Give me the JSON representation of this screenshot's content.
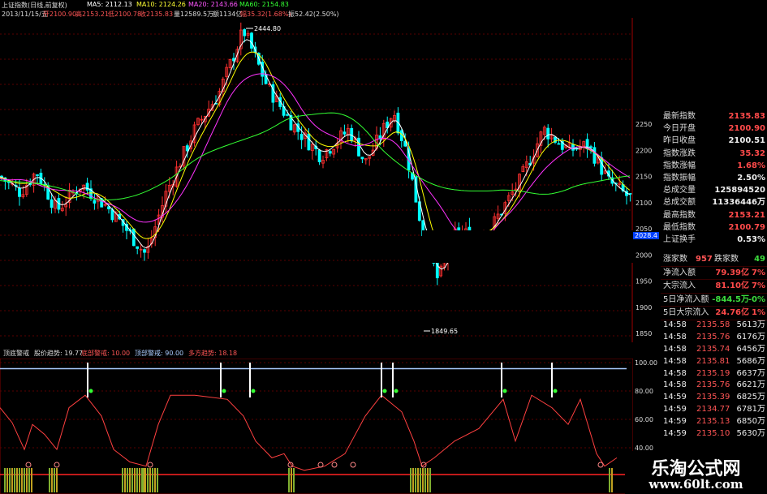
{
  "infobar": {
    "title": "上证指数(日线,前复权)",
    "ma5": "MA5: 2112.13",
    "ma10": "MA10: 2124.26",
    "ma20": "MA20: 2143.66",
    "ma60": "MA60: 2154.83",
    "date": "2013/11/15/五",
    "open": "开2100.90",
    "high": "高2153.21",
    "low": "低2100.78",
    "close": "收2135.83",
    "volume": "量12589.5万",
    "amount": "额1134亿",
    "change": "幅35.32(1.68%)",
    "amp": "振52.42(2.50%)"
  },
  "annotations": {
    "peak": "2444.80",
    "trough": "1849.65"
  },
  "main_axis": {
    "labels": [
      "2250",
      "2200",
      "2150",
      "2100",
      "2050",
      "2000",
      "1950",
      "1900",
      "1850"
    ],
    "current": "2028.4"
  },
  "indicator_bar": {
    "name": "顶底警戒",
    "trend": "股价趋势: 19.77",
    "bottom": "底部警戒: 10.00",
    "top": "顶部警戒: 90.00",
    "bull": "多方趋势: 18.18"
  },
  "ind_axis": {
    "labels": [
      "100.00",
      "80.00",
      "60.00",
      "40.00"
    ]
  },
  "panel": [
    {
      "label": "最新指数",
      "value": "2135.83",
      "color": "red"
    },
    {
      "label": "今日开盘",
      "value": "2100.90",
      "color": "red"
    },
    {
      "label": "昨日收盘",
      "value": "2100.51",
      "color": "white"
    },
    {
      "label": "指数涨跌",
      "value": "35.32",
      "color": "red"
    },
    {
      "label": "指数涨幅",
      "value": "1.68%",
      "color": "red"
    },
    {
      "label": "指数振幅",
      "value": "2.50%",
      "color": "white"
    },
    {
      "label": "总成交量",
      "value": "125894520",
      "color": "white"
    },
    {
      "label": "总成交额",
      "value": "11336446万",
      "color": "white"
    },
    {
      "label": "最高指数",
      "value": "2153.21",
      "color": "red"
    },
    {
      "label": "最低指数",
      "value": "2100.79",
      "color": "red"
    },
    {
      "label": "上证换手",
      "value": "0.53%",
      "color": "white"
    }
  ],
  "flow": {
    "rise_label": "涨家数",
    "rise_value": "957",
    "fall_label": "跌家数",
    "fall_value": "49",
    "rows": [
      {
        "label": "净流入额",
        "value": "79.39亿",
        "pct": "7%",
        "color": "red"
      },
      {
        "label": "大宗流入",
        "value": "81.10亿",
        "pct": "7%",
        "color": "red"
      },
      {
        "label": "5日净流入额",
        "value": "-844.5万",
        "pct": "-0%",
        "color": "green"
      },
      {
        "label": "5日大宗流入",
        "value": "24.76亿",
        "pct": "1%",
        "color": "red"
      }
    ]
  },
  "ticks": [
    {
      "time": "14:58",
      "price": "2135.58",
      "vol": "5613万"
    },
    {
      "time": "14:58",
      "price": "2135.76",
      "vol": "6176万"
    },
    {
      "time": "14:58",
      "price": "2135.74",
      "vol": "6456万"
    },
    {
      "time": "14:58",
      "price": "2135.81",
      "vol": "5686万"
    },
    {
      "time": "14:58",
      "price": "2135.19",
      "vol": "6637万"
    },
    {
      "time": "14:58",
      "price": "2135.76",
      "vol": "6621万"
    },
    {
      "time": "14:59",
      "price": "2135.39",
      "vol": "6825万"
    },
    {
      "time": "14:59",
      "price": "2134.77",
      "vol": "6781万"
    },
    {
      "time": "14:59",
      "price": "2135.13",
      "vol": "6850万"
    },
    {
      "time": "14:59",
      "price": "2135.10",
      "vol": "5630万"
    }
  ],
  "watermark": {
    "line1": "乐淘公式网",
    "line2": "www.60lt.com"
  },
  "colors": {
    "ma5": "#ffffff",
    "ma10": "#ffff00",
    "ma20": "#ff33ff",
    "ma60": "#33ff33",
    "up": "#ff3030",
    "down": "#00ffff",
    "indicator": "#ff4040",
    "toplevel": "#aaccff"
  }
}
